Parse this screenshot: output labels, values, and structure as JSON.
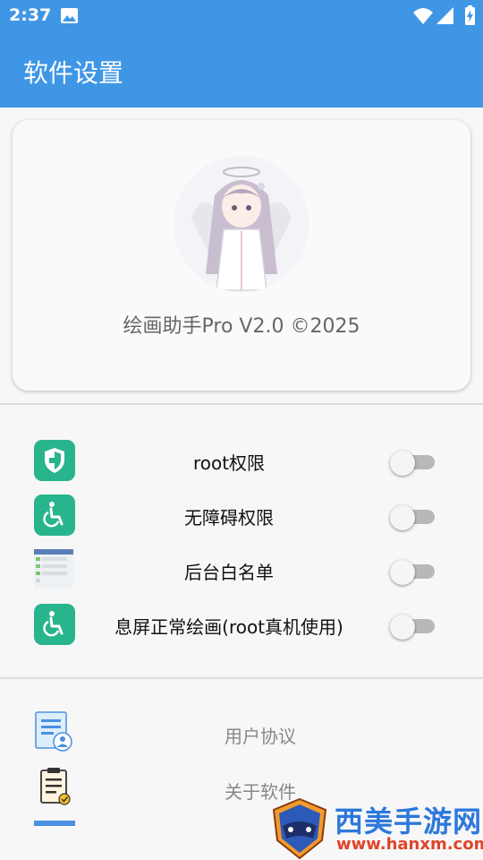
{
  "status_bar": {
    "time": "2:37"
  },
  "app_bar": {
    "title": "软件设置"
  },
  "profile": {
    "version_text": "绘画助手Pro V2.0 ©2025"
  },
  "permissions": [
    {
      "label": "root权限",
      "icon": "shield-icon",
      "enabled": false
    },
    {
      "label": "无障碍权限",
      "icon": "accessibility-icon",
      "enabled": false
    },
    {
      "label": "后台白名单",
      "icon": "app-window-icon",
      "enabled": false
    },
    {
      "label": "息屏正常绘画(root真机使用)",
      "icon": "accessibility-icon",
      "enabled": false
    }
  ],
  "links": [
    {
      "label": "用户协议",
      "icon": "user-agreement-icon"
    },
    {
      "label": "关于软件",
      "icon": "about-clipboard-icon"
    }
  ],
  "watermark": {
    "title": "西美手游网",
    "url": "www.hanxm.com"
  },
  "colors": {
    "primary": "#3f96e5",
    "icon_green": "#28b48c",
    "switch_track": "#b8b8b8",
    "switch_thumb": "#f5f5f5"
  }
}
